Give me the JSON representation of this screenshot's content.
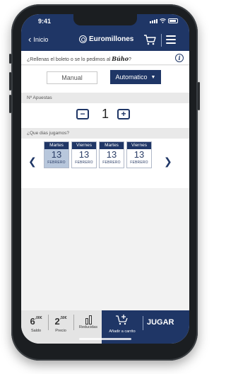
{
  "status_bar": {
    "time": "9:41"
  },
  "nav": {
    "back_label": "Inicio",
    "brand": "Euromillones",
    "cart_icon": "cart-icon",
    "menu_icon": "hamburger-menu-icon"
  },
  "question": {
    "text": "¿Rellenas el boleto o se lo pedimos al",
    "highlight": "Búho",
    "suffix": "?",
    "info_label": "i"
  },
  "mode": {
    "manual_label": "Manual",
    "automatic_label": "Automatico",
    "selected": "Automatico"
  },
  "bets": {
    "header": "Nº Apuestas",
    "minus_label": "−",
    "plus_label": "+",
    "count": "1"
  },
  "days": {
    "header": "¿Que dias jugamos?",
    "prev_icon": "chevron-left-icon",
    "next_icon": "chevron-right-icon",
    "items": [
      {
        "day": "Martes",
        "date": "13",
        "month": "FEBRERO",
        "selected": true
      },
      {
        "day": "Viernes",
        "date": "13",
        "month": "FEBRERO",
        "selected": false
      },
      {
        "day": "Martes",
        "date": "13",
        "month": "FEBRERO",
        "selected": false
      },
      {
        "day": "Viernes",
        "date": "13",
        "month": "FEBRERO",
        "selected": false
      }
    ]
  },
  "bottom": {
    "saldo_value": "6",
    "saldo_sup": ",00€",
    "saldo_label": "Saldo",
    "precio_value": "2",
    "precio_sup": ",50€",
    "precio_label": "Precio",
    "reducidas_label": "Reducidas",
    "add_cart_label": "Añadir a carrito",
    "play_label": "JUGAR"
  },
  "colors": {
    "primary": "#1f3666",
    "selected_day": "#b8c7dc",
    "stats_bg": "#e4e4e4"
  }
}
